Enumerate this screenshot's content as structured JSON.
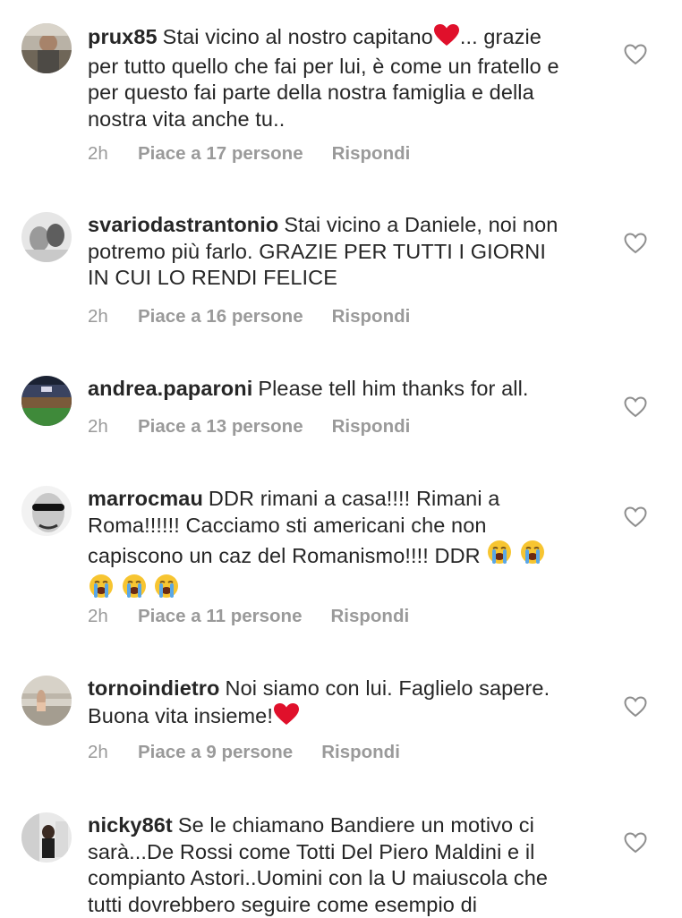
{
  "comments": [
    {
      "username": "prux85",
      "text": "Stai vicino al nostro capitano",
      "text_after": "... grazie per tutto quello che fai per lui, è come un fratello e per questo fai parte della nostra famiglia e della nostra vita anche tu..",
      "time": "2h",
      "likes": "Piace a 17 persone",
      "reply": "Rispondi"
    },
    {
      "username": "svariodastrantonio",
      "text": "Stai vicino a Daniele, noi non potremo più farlo. GRAZIE PER TUTTI I GIORNI IN CUI LO RENDI FELICE",
      "time": "2h",
      "likes": "Piace a 16 persone",
      "reply": "Rispondi"
    },
    {
      "username": "andrea.paparoni",
      "text": "Please tell him thanks for all.",
      "time": "2h",
      "likes": "Piace a 13 persone",
      "reply": "Rispondi"
    },
    {
      "username": "marrocmau",
      "text": "DDR rimani a casa!!!! Rimani a Roma!!!!!! Cacciamo sti americani che non capiscono un caz del Romanismo!!!! DDR",
      "time": "2h",
      "likes": "Piace a 11 persone",
      "reply": "Rispondi"
    },
    {
      "username": "tornoindietro",
      "text": "Noi siamo con lui. Faglielo sapere. Buona vita insieme!",
      "time": "2h",
      "likes": "Piace a 9 persone",
      "reply": "Rispondi"
    },
    {
      "username": "nicky86t",
      "text": "Se le chiamano Bandiere un motivo ci sarà...De Rossi come Totti Del Piero Maldini e il compianto Astori..Uomini con la U maiuscola che tutti dovrebbero seguire come esempio di"
    }
  ],
  "icons": {
    "like": "heart-outline-icon",
    "red_heart": "red-heart-emoji",
    "crying": "loudly-crying-face-emoji"
  },
  "colors": {
    "text": "#262626",
    "meta": "#9a9a9a",
    "red_heart": "#e0102b",
    "crying_face": "#f7c531",
    "tears": "#5aa7e6"
  }
}
